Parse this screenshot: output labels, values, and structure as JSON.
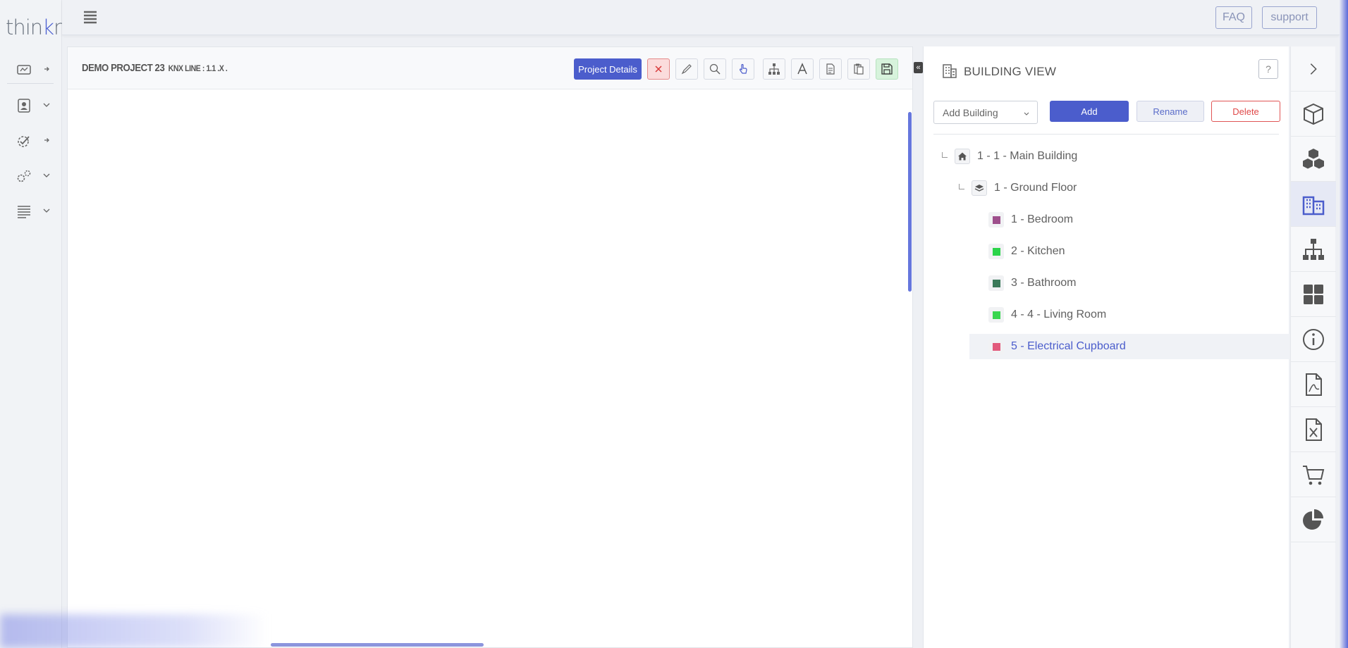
{
  "app": {
    "logo_prefix": "thin",
    "logo_k": "k",
    "logo_suffix": "nx"
  },
  "topbar": {
    "faq_label": "FAQ",
    "support_label": "support"
  },
  "canvas": {
    "project_title": "DEMO PROJECT 23",
    "project_subtitle": "KNX LINE : 1.1 .X .",
    "details_label": "Project Details",
    "collapse_glyph": "«"
  },
  "building_view": {
    "title": "BUILDING VIEW",
    "help_label": "?",
    "select_value": "Add Building",
    "add_label": "Add",
    "rename_label": "Rename",
    "delete_label": "Delete",
    "tree": {
      "building": "1 - 1 - Main Building",
      "floor": "1 - Ground Floor",
      "rooms": [
        {
          "label": "1 - Bedroom",
          "color": "#9e4f8c"
        },
        {
          "label": "2 - Kitchen",
          "color": "#2bd44a"
        },
        {
          "label": "3 - Bathroom",
          "color": "#3b7a5a"
        },
        {
          "label": "4 - 4 - Living Room",
          "color": "#3ad650"
        },
        {
          "label": "5 - Electrical Cupboard",
          "color": "#e25a7c"
        }
      ]
    }
  },
  "colors": {
    "accent": "#4b5dcc",
    "danger": "#e04848"
  },
  "icons": {
    "left_nav": [
      "dashboard-icon",
      "user-icon",
      "check-settings-icon",
      "gears-icon",
      "list-icon"
    ],
    "toolbar": [
      "close-icon",
      "pencil-icon",
      "search-icon",
      "pointer-icon",
      "hierarchy-icon",
      "text-icon",
      "document-icon",
      "paste-icon",
      "save-icon"
    ],
    "right_rail": [
      "chevron-right-icon",
      "cube-icon",
      "cubes-icon",
      "building-icon",
      "sitemap-icon",
      "grid-icon",
      "info-icon",
      "pdf-icon",
      "excel-icon",
      "cart-icon",
      "pie-chart-icon"
    ]
  }
}
